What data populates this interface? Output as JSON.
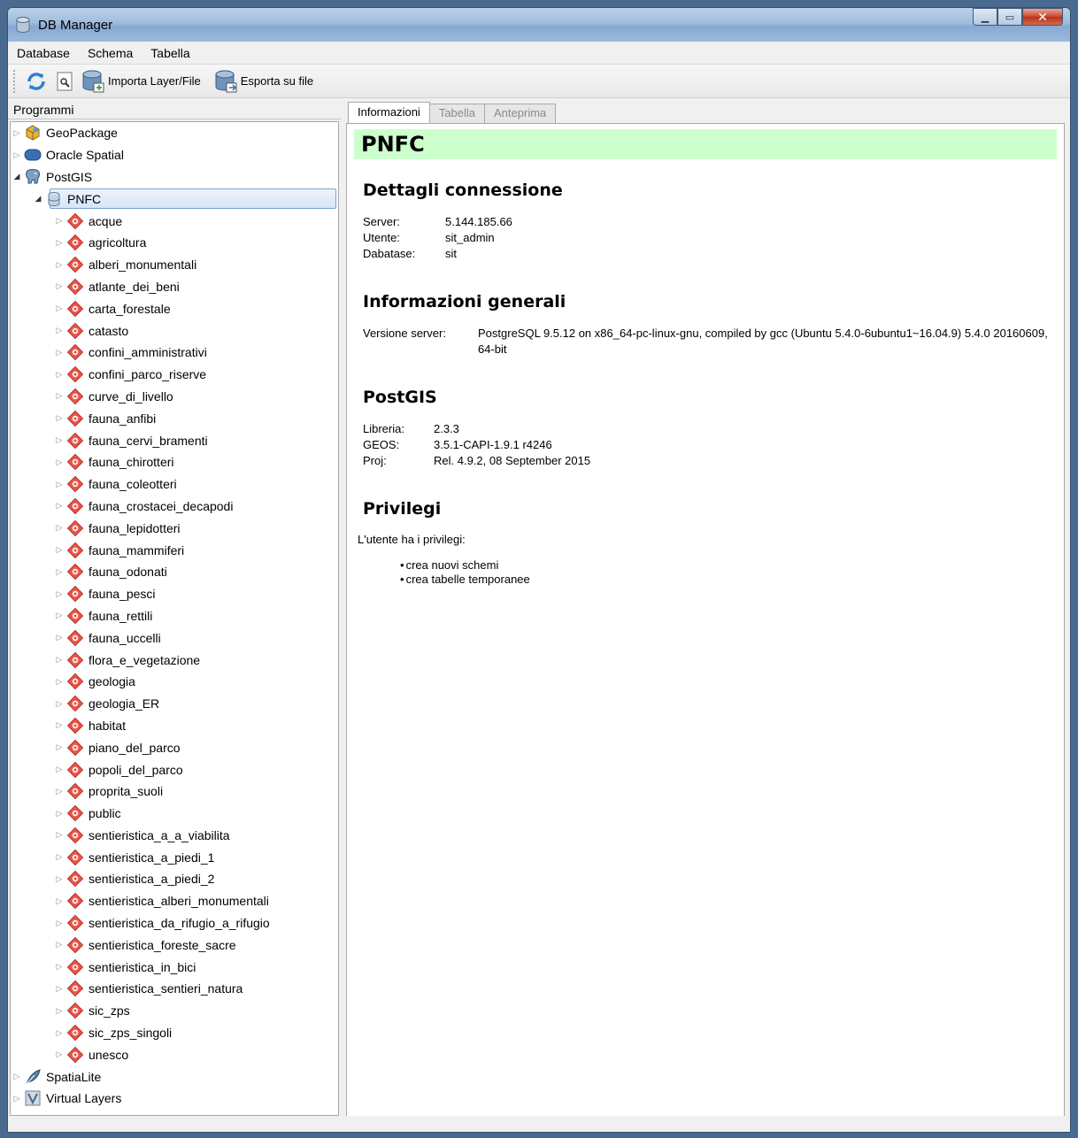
{
  "window": {
    "title": "DB Manager"
  },
  "menu": [
    "Database",
    "Schema",
    "Tabella"
  ],
  "toolbar": {
    "import_label": "Importa Layer/File",
    "export_label": "Esporta su file"
  },
  "left": {
    "header": "Programmi",
    "providers_top": [
      {
        "label": "GeoPackage",
        "icon": "geopackage-icon"
      },
      {
        "label": "Oracle Spatial",
        "icon": "oracle-icon"
      },
      {
        "label": "PostGIS",
        "icon": "postgis-elephant-icon"
      }
    ],
    "connection": "PNFC",
    "schemas": [
      "acque",
      "agricoltura",
      "alberi_monumentali",
      "atlante_dei_beni",
      "carta_forestale",
      "catasto",
      "confini_amministrativi",
      "confini_parco_riserve",
      "curve_di_livello",
      "fauna_anfibi",
      "fauna_cervi_bramenti",
      "fauna_chirotteri",
      "fauna_coleotteri",
      "fauna_crostacei_decapodi",
      "fauna_lepidotteri",
      "fauna_mammiferi",
      "fauna_odonati",
      "fauna_pesci",
      "fauna_rettili",
      "fauna_uccelli",
      "flora_e_vegetazione",
      "geologia",
      "geologia_ER",
      "habitat",
      "piano_del_parco",
      "popoli_del_parco",
      "proprita_suoli",
      "public",
      "sentieristica_a_a_viabilita",
      "sentieristica_a_piedi_1",
      "sentieristica_a_piedi_2",
      "sentieristica_alberi_monumentali",
      "sentieristica_da_rifugio_a_rifugio",
      "sentieristica_foreste_sacre",
      "sentieristica_in_bici",
      "sentieristica_sentieri_natura",
      "sic_zps",
      "sic_zps_singoli",
      "unesco"
    ],
    "providers_bottom": [
      {
        "label": "SpatiaLite",
        "icon": "feather-icon"
      },
      {
        "label": "Virtual Layers",
        "icon": "virtual-layers-icon"
      }
    ]
  },
  "tabs": [
    {
      "label": "Informazioni",
      "active": true
    },
    {
      "label": "Tabella",
      "active": false
    },
    {
      "label": "Anteprima",
      "active": false
    }
  ],
  "info": {
    "title": "PNFC",
    "title_bg": "#ccffcc",
    "connection": {
      "heading": "Dettagli connessione",
      "rows": [
        {
          "k": "Server:",
          "v": "5.144.185.66"
        },
        {
          "k": "Utente:",
          "v": "sit_admin"
        },
        {
          "k": "Dabatase:",
          "v": "sit"
        }
      ]
    },
    "general": {
      "heading": "Informazioni generali",
      "k": "Versione server:",
      "v": "PostgreSQL 9.5.12 on x86_64-pc-linux-gnu, compiled by gcc (Ubuntu 5.4.0-6ubuntu1~16.04.9) 5.4.0 20160609, 64-bit"
    },
    "postgis": {
      "heading": "PostGIS",
      "rows": [
        {
          "k": "Libreria:",
          "v": "2.3.3"
        },
        {
          "k": "GEOS:",
          "v": "3.5.1-CAPI-1.9.1 r4246"
        },
        {
          "k": "Proj:",
          "v": "Rel. 4.9.2, 08 September 2015"
        }
      ]
    },
    "privileges": {
      "heading": "Privilegi",
      "intro": "L'utente ha i privilegi:",
      "items": [
        "crea nuovi schemi",
        "crea tabelle temporanee"
      ]
    }
  }
}
